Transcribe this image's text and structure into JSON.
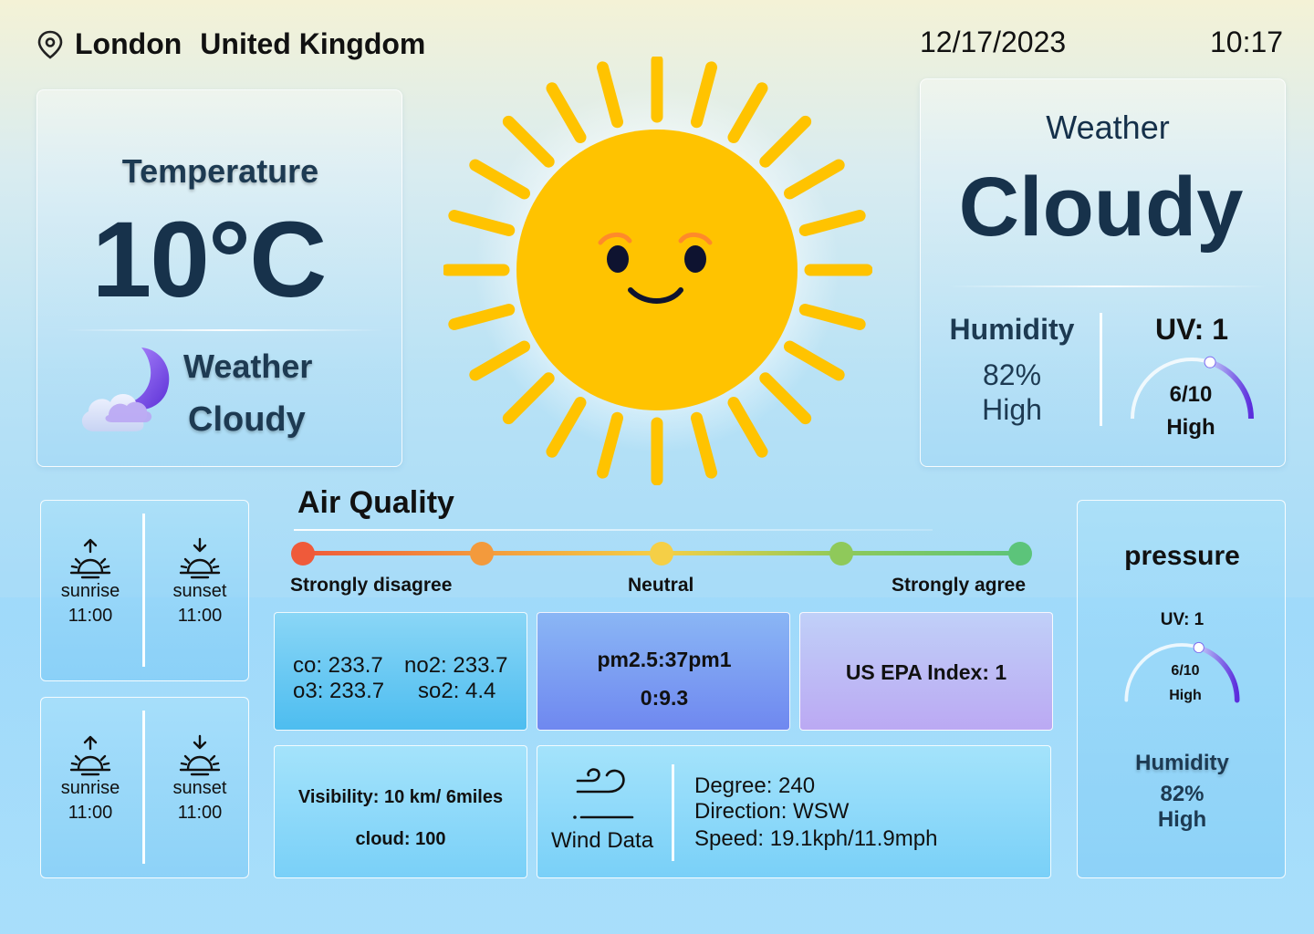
{
  "header": {
    "city": "London",
    "country": "United Kingdom",
    "date": "12/17/2023",
    "time": "10:17",
    "location_icon": "location-pin-icon"
  },
  "temperature_card": {
    "title": "Temperature",
    "value": "10°C",
    "weather_label": "Weather",
    "weather_value": "Cloudy",
    "icon": "moon-cloud-icon"
  },
  "weather_card": {
    "title": "Weather",
    "value": "Cloudy",
    "humidity_label": "Humidity",
    "humidity_value": "82%",
    "humidity_level": "High",
    "uv_label": "UV: 1",
    "uv_score": "6/10",
    "uv_fraction": 0.6,
    "uv_level": "High"
  },
  "sun_times": [
    {
      "sunrise_label": "sunrise",
      "sunrise_time": "11:00",
      "sunset_label": "sunset",
      "sunset_time": "11:00"
    },
    {
      "sunrise_label": "sunrise",
      "sunrise_time": "11:00",
      "sunset_label": "sunset",
      "sunset_time": "11:00"
    }
  ],
  "air_quality": {
    "title": "Air Quality",
    "scale_labels": {
      "left": "Strongly disagree",
      "middle": "Neutral",
      "right": "Strongly agree"
    },
    "scale_colors": [
      "#ef5a3a",
      "#f39a3c",
      "#f5cf46",
      "#8fc95a",
      "#5cc47a"
    ],
    "pollutants": {
      "co": "co: 233.7",
      "no2": "no2: 233.7",
      "o3": "o3: 233.7",
      "so2": "so2: 4.4"
    },
    "pm_line1": "pm2.5:37pm1",
    "pm_line2": "0:9.3",
    "epa": "US EPA Index: 1"
  },
  "visibility": {
    "visibility": "Visibility: 10 km/ 6miles",
    "cloud": "cloud: 100"
  },
  "wind": {
    "label": "Wind Data",
    "degree": "Degree: 240",
    "direction": "Direction: WSW",
    "speed": "Speed: 19.1kph/11.9mph",
    "icon": "wind-icon"
  },
  "pressure_card": {
    "title": "pressure",
    "uv_label": "UV: 1",
    "uv_score": "6/10",
    "uv_fraction": 0.6,
    "uv_level": "High",
    "humidity_label": "Humidity",
    "humidity_value": "82%",
    "humidity_level": "High"
  },
  "hero_icon": "smiling-sun-icon",
  "colors": {
    "text_dark": "#17324b",
    "gauge_gradient_start": "#c9d6fb",
    "gauge_gradient_end": "#5b2ddc"
  }
}
